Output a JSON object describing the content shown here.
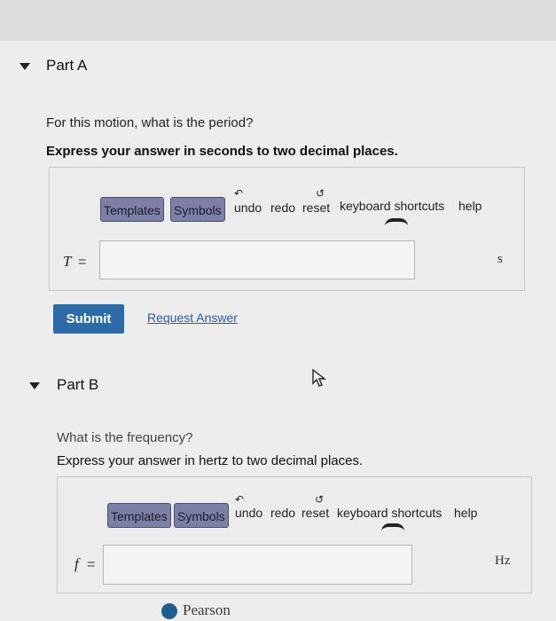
{
  "part_a": {
    "title": "Part A",
    "question": "For this motion, what is the period?",
    "instruction": "Express your answer in seconds to two decimal places.",
    "variable": "T",
    "equals": "=",
    "input_value": "",
    "unit": "s"
  },
  "part_b": {
    "title": "Part B",
    "question": "What is the frequency?",
    "instruction": "Express your answer in hertz to two decimal places.",
    "variable": "f",
    "equals": "=",
    "input_value": "",
    "unit": "Hz"
  },
  "toolbar": {
    "templates": "Templates",
    "symbols": "Symbols",
    "undo": "undo",
    "redo": "redo",
    "reset": "reset",
    "keyboard_shortcuts": "keyboard shortcuts",
    "help": "help"
  },
  "actions": {
    "submit": "Submit",
    "request_answer": "Request Answer"
  },
  "footer": {
    "brand": "Pearson"
  },
  "colors": {
    "submit": "#2d6aa8",
    "link": "#2a5aa8",
    "toolbar_button": "#7c7fa6"
  }
}
